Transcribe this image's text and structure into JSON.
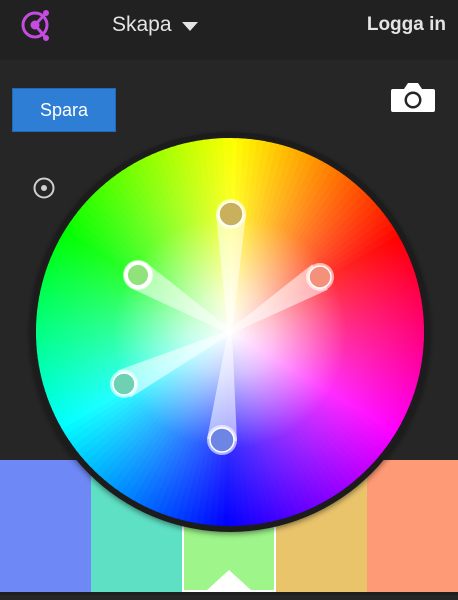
{
  "header": {
    "menu_label": "Skapa",
    "login_label": "Logga in",
    "logo_icon": "color-wheel-logo-icon",
    "menu_caret_icon": "caret-down-icon"
  },
  "toolbar": {
    "save_label": "Spara",
    "camera_icon": "camera-icon",
    "target_icon": "target-icon"
  },
  "wheel": {
    "base_hue_swatch_index": 2,
    "handles": [
      {
        "name": "handle-1",
        "color": "#c9b05c"
      },
      {
        "name": "handle-2",
        "color": "#f5917a"
      },
      {
        "name": "handle-3",
        "color": "#8fe37a"
      },
      {
        "name": "handle-4",
        "color": "#6ed1b4"
      },
      {
        "name": "handle-5",
        "color": "#6d86e6"
      }
    ]
  },
  "swatches": [
    {
      "color": "#6e88f5"
    },
    {
      "color": "#5ee0c4"
    },
    {
      "color": "#9ef58a"
    },
    {
      "color": "#e9c46b"
    },
    {
      "color": "#ff9a76"
    }
  ]
}
